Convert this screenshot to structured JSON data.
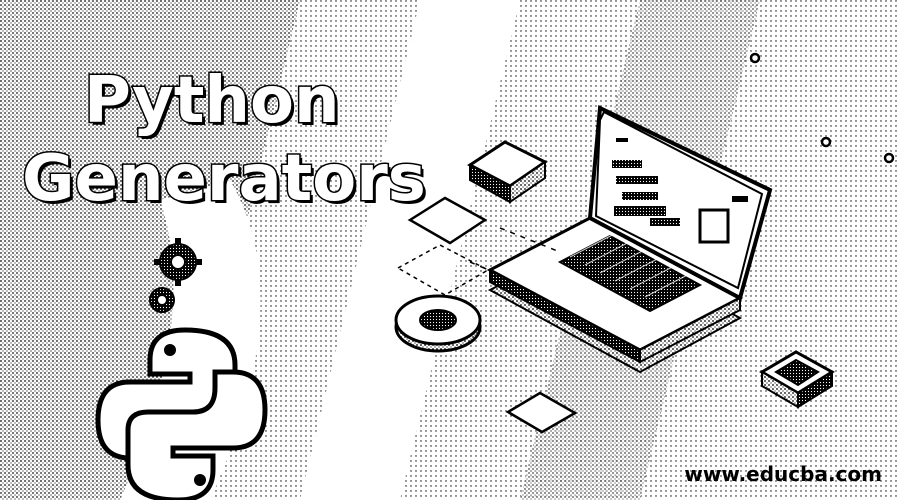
{
  "banner": {
    "title_line1": "Python",
    "title_line2": "Generators",
    "website": "www.educba.com"
  },
  "colors": {
    "ink": "#000000",
    "paper": "#ffffff"
  },
  "icons": [
    "python-logo-icon",
    "gear-icon",
    "laptop-icon",
    "chip-icon"
  ]
}
